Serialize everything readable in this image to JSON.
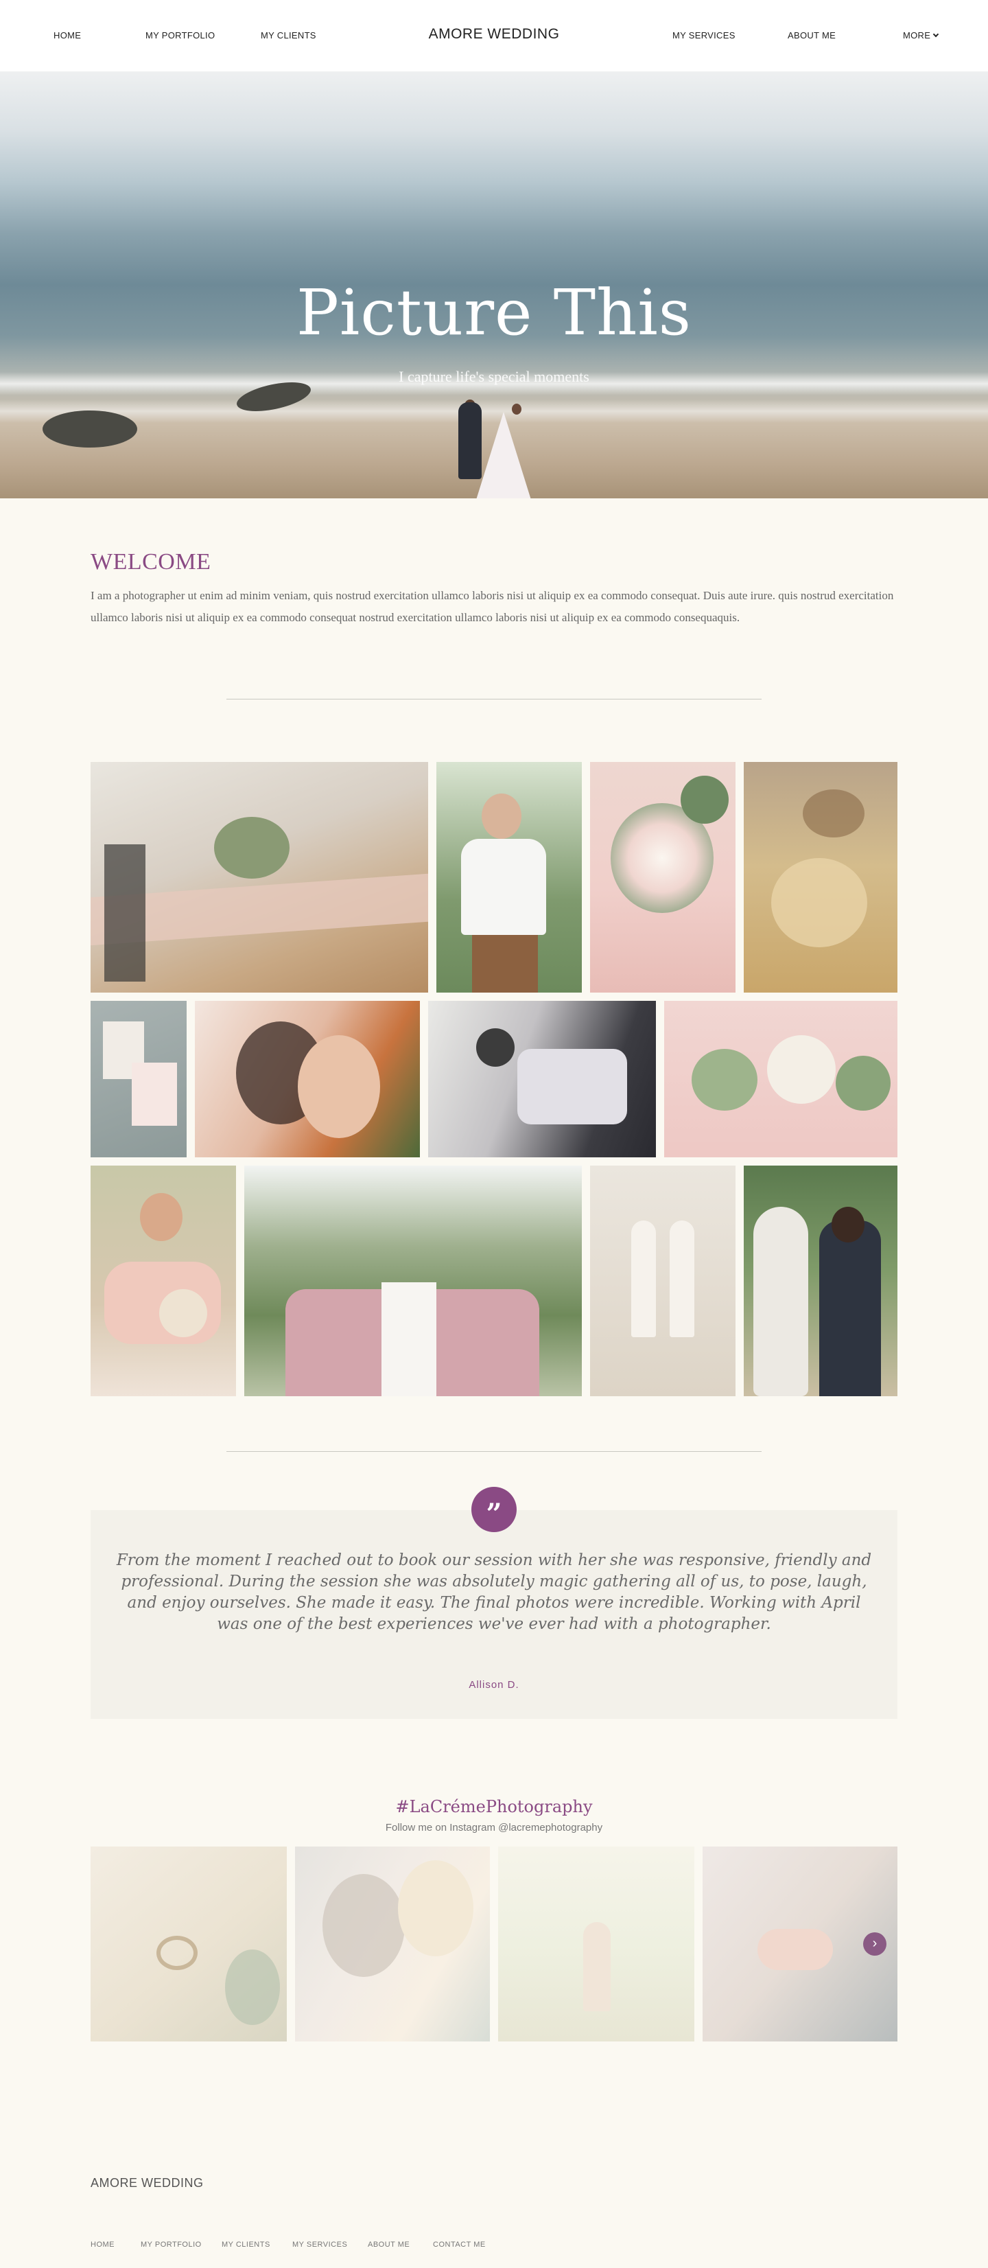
{
  "nav": {
    "left": [
      "HOME",
      "MY PORTFOLIO",
      "MY CLIENTS"
    ],
    "brand": "AMORE WEDDING",
    "right": [
      "MY SERVICES",
      "ABOUT ME",
      "MORE"
    ]
  },
  "hero": {
    "title": "Picture This",
    "subtitle": "I capture life's special moments",
    "icons": {
      "more_chevron": "chevron-down-icon"
    }
  },
  "welcome": {
    "title": "WELCOME",
    "text": "I am a photographer ut enim ad minim veniam, quis nostrud exercitation ullamco laboris nisi ut aliquip ex ea commodo consequat. Duis aute irure. quis nostrud exercitation ullamco laboris nisi ut aliquip ex ea commodo consequat nostrud exercitation ullamco laboris nisi ut aliquip ex ea commodo consequaquis."
  },
  "gallery": {
    "photos": [
      "wedding-table-photo",
      "groom-photo",
      "bouquet-photo",
      "bride-jewelry-photo",
      "invitation-cards-photo",
      "couple-embrace-photo",
      "cufflinks-photo",
      "bridesmaids-bouquets-photo",
      "bride-portrait-photo",
      "bridal-party-photo",
      "wedding-shoes-photo",
      "groom-horse-photo"
    ]
  },
  "testimonial": {
    "quote_mark": "”",
    "text": "From the moment I reached out to book our session with her she was responsive, friendly and professional. During the session she was absolutely magic gathering all of us, to pose, laugh, and enjoy ourselves. She made it easy. The final photos were incredible. Working with April was one of the best experiences we've ever had with a photographer.",
    "author": "Allison D."
  },
  "instagram": {
    "tag": "#LaCrémePhotography",
    "subtitle": "Follow me on Instagram @lacremephotography",
    "next_icon": "chevron-right-icon"
  },
  "footer": {
    "brand": "AMORE WEDDING",
    "links": [
      "HOME",
      "MY PORTFOLIO",
      "MY CLIENTS",
      "MY SERVICES",
      "ABOUT ME",
      "CONTACT ME"
    ]
  },
  "colors": {
    "accent": "#8a4a84",
    "background": "#fbf9f2",
    "quote_box": "#f3f1ea"
  }
}
